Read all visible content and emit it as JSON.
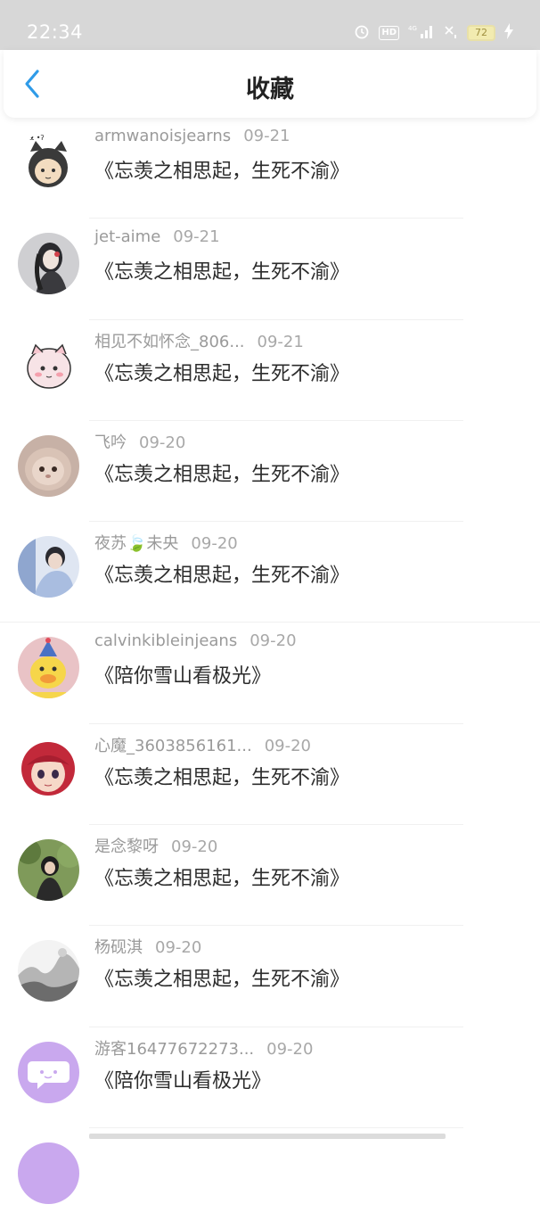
{
  "status_bar": {
    "time": "22:34",
    "hd": "HD",
    "network": "4G",
    "battery": "72"
  },
  "header": {
    "title": "收藏",
    "back_icon": "chevron-left-icon",
    "accent_color": "#2f9be8"
  },
  "items": [
    {
      "user": "armwanoisjearns",
      "date": "09-21",
      "title": "《忘羡之相思起，生死不渝》",
      "avatar": "cat-avatar"
    },
    {
      "user": "jet-aime",
      "date": "09-21",
      "title": "《忘羡之相思起，生死不渝》",
      "avatar": "girl-photo-avatar"
    },
    {
      "user": "相见不如怀念_806...",
      "date": "09-21",
      "title": "《忘羡之相思起，生死不渝》",
      "avatar": "cartoon-avatar"
    },
    {
      "user": "飞吟",
      "date": "09-20",
      "title": "《忘羡之相思起，生死不渝》",
      "avatar": "kitten-avatar"
    },
    {
      "user": "夜苏🍃未央",
      "date": "09-20",
      "title": "《忘羡之相思起，生死不渝》",
      "avatar": "boy-photo-avatar"
    },
    {
      "user": "calvinkibleinjeans",
      "date": "09-20",
      "title": "《陪你雪山看极光》",
      "avatar": "duck-avatar"
    },
    {
      "user": "心魔_3603856161...",
      "date": "09-20",
      "title": "《忘羡之相思起，生死不渝》",
      "avatar": "anime-girl-avatar"
    },
    {
      "user": "是念黎呀",
      "date": "09-20",
      "title": "《忘羡之相思起，生死不渝》",
      "avatar": "forest-avatar"
    },
    {
      "user": "杨砚淇",
      "date": "09-20",
      "title": "《忘羡之相思起，生死不渝》",
      "avatar": "ink-landscape-avatar"
    },
    {
      "user": "游客16477672273...",
      "date": "09-20",
      "title": "《陪你雪山看极光》",
      "avatar": "guest-chat-avatar"
    }
  ]
}
